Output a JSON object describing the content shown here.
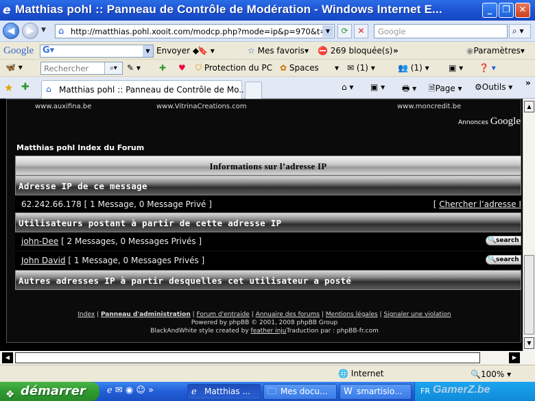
{
  "window": {
    "title": "Matthias pohl :: Panneau de Contrôle de Modération - Windows Internet E...",
    "buttons": {
      "minimize": "_",
      "maximize": "❐",
      "close": "✕"
    }
  },
  "address_bar": {
    "url": "http://matthias.pohl.xooit.com/modcp.php?mode=ip&p=970&t=1",
    "search_placeholder": "Google"
  },
  "google_toolbar": {
    "logo": "Google",
    "envoyer": "Envoyer",
    "mes_favoris": "Mes favoris",
    "bloquees": "269 bloquée(s)",
    "more": "»",
    "parametres": "Paramètres"
  },
  "links_toolbar": {
    "search_placeholder": "Rechercher",
    "protection": "Protection du PC",
    "spaces": "Spaces",
    "mail_count": "(1)",
    "contacts_count": "(1)"
  },
  "tabs": {
    "active_label": "Matthias pohl :: Panneau de Contrôle de Mo...",
    "page_menu": "Page",
    "outils_menu": "Outils",
    "more": "»"
  },
  "page": {
    "ads": [
      "www.auxifina.be",
      "www.VitrinaCreations.com",
      "www.moncredit.be"
    ],
    "ads_label": "Annonces",
    "ads_brand": "Google",
    "forum_index": "Matthias pohl Index du Forum",
    "ip_info_header": "Informations sur l’adresse IP",
    "ip_section_title": "Adresse IP de ce message",
    "ip_row": {
      "ip": "62.242.66.178",
      "detail": "[ 1 Message, 0 Message Privé ]",
      "lookup_prefix": "[ ",
      "lookup_link": "Chercher l’adresse I"
    },
    "users_section_title": "Utilisateurs postant à partir de cette adresse IP",
    "users": [
      {
        "name": "john-Dee",
        "detail": "[ 2 Messages, 0 Messages Privés ]",
        "button": "search"
      },
      {
        "name": "John David",
        "detail": "[ 1 Message, 0 Messages Privés ]",
        "button": "search"
      }
    ],
    "other_ips_title": "Autres adresses IP à partir desquelles cet utilisateur a posté",
    "footer": {
      "links": [
        "Index",
        "Panneau d'administration",
        "Forum d'entraide",
        "Annuaire des forums",
        "Mentions légales",
        "Signaler une violation"
      ],
      "powered_prefix": "Powered by ",
      "powered_name": "phpBB",
      "powered_suffix": " © 2001, 2008 phpBB Group",
      "style_prefix": "BlackAndWhite style created by ",
      "style_author": "feather inju",
      "translation": "Traduction par : phpBB-fr.com"
    }
  },
  "status_bar": {
    "zone": "Internet",
    "zoom": "100%"
  },
  "taskbar": {
    "start": "démarrer",
    "tasks": [
      "Matthias ...",
      "Mes docu...",
      "smartisio..."
    ],
    "tray_lang": "FR",
    "watermark": "GamerZ.be"
  }
}
